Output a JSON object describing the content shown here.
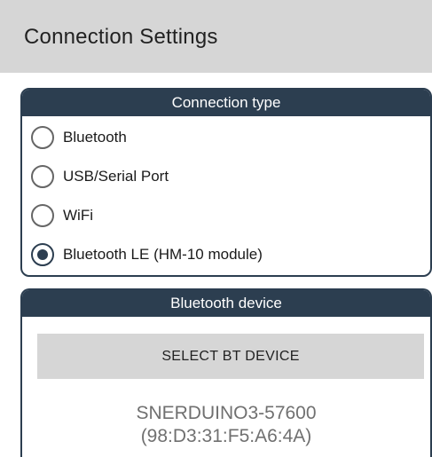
{
  "header": {
    "title": "Connection Settings"
  },
  "connection_type": {
    "title": "Connection type",
    "options": [
      {
        "label": "Bluetooth",
        "checked": false
      },
      {
        "label": "USB/Serial Port",
        "checked": false
      },
      {
        "label": "WiFi",
        "checked": false
      },
      {
        "label": "Bluetooth LE (HM-10 module)",
        "checked": true
      }
    ]
  },
  "bluetooth_device": {
    "title": "Bluetooth device",
    "select_button": "SELECT BT DEVICE",
    "device_name": "SNERDUINO3-57600",
    "device_address": "(98:D3:31:F5:A6:4A)"
  },
  "colors": {
    "accent": "#2c3e50",
    "toolbar": "#d6d6d6",
    "muted_text": "#707070"
  }
}
